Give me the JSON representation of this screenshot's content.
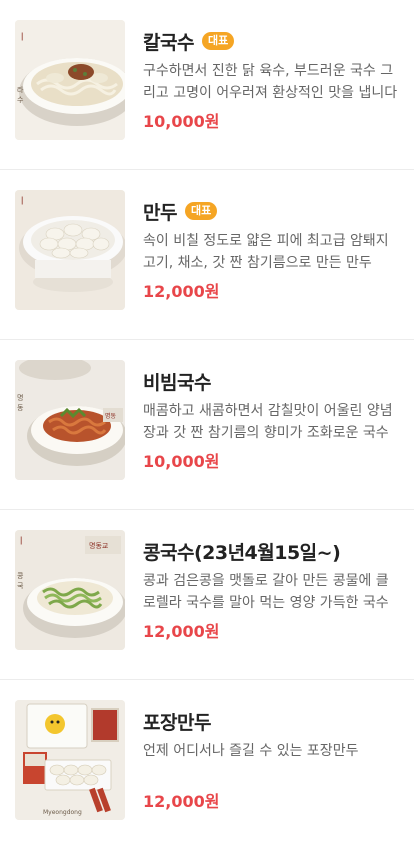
{
  "menu": {
    "items": [
      {
        "name": "칼국수",
        "badge": "대표",
        "description": "구수하면서 진한 닭 육수, 부드러운 국수 그리고 고명이 어우러져 환상적인 맛을 냅니다",
        "price": "10,000원",
        "image": "kalguksu-photo"
      },
      {
        "name": "만두",
        "badge": "대표",
        "description": "속이 비칠 정도로 얇은 피에 최고급 암퇘지 고기, 채소, 갓 짠 참기름으로 만든 만두",
        "price": "12,000원",
        "image": "mandu-photo"
      },
      {
        "name": "비빔국수",
        "description": "매콤하고 새콤하면서 감칠맛이 어울린 양념장과 갓 짠 참기름의 향미가 조화로운 국수",
        "price": "10,000원",
        "image": "bibim-guksu-photo"
      },
      {
        "name": "콩국수(23년4월15일~)",
        "description": "콩과 검은콩을 맷돌로 갈아 만든 콩물에 클로렐라 국수를 말아 먹는 영양 가득한 국수",
        "price": "12,000원",
        "image": "kongguksu-photo"
      },
      {
        "name": "포장만두",
        "description": "언제 어디서나 즐길 수 있는 포장만두",
        "price": "12,000원",
        "image": "takeout-mandu-photo"
      }
    ]
  }
}
